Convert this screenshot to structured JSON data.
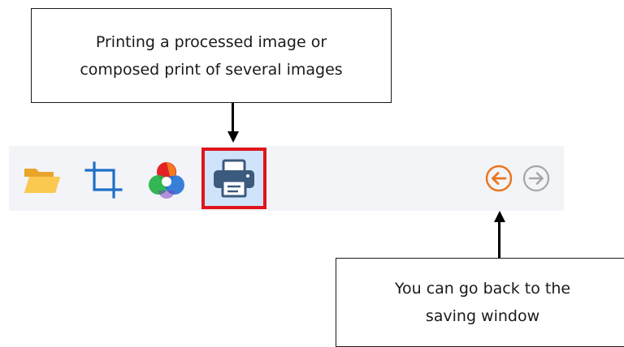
{
  "callouts": {
    "print": {
      "line1": "Printing a processed image or",
      "line2": "composed print of several images"
    },
    "back": {
      "line1": "You can go back to the",
      "line2": "saving window"
    }
  },
  "toolbar": {
    "tools": [
      {
        "icon": "folder-open-icon"
      },
      {
        "icon": "crop-icon"
      },
      {
        "icon": "color-wheel-icon"
      },
      {
        "icon": "printer-icon",
        "highlighted": true
      }
    ],
    "navigation": [
      {
        "icon": "arrow-left-circle-icon",
        "enabled": true
      },
      {
        "icon": "arrow-right-circle-icon",
        "enabled": false
      }
    ]
  },
  "colors": {
    "toolbar_bg": "#f3f4f8",
    "highlight_border": "#e1141b",
    "highlight_fill": "#cfe4fb",
    "back_arrow": "#e8761f",
    "forward_arrow_disabled": "#a6a6a6",
    "crop_icon": "#1f6fc8",
    "folder_icon": "#f6b83b",
    "printer_icon": "#3c5a7d"
  }
}
